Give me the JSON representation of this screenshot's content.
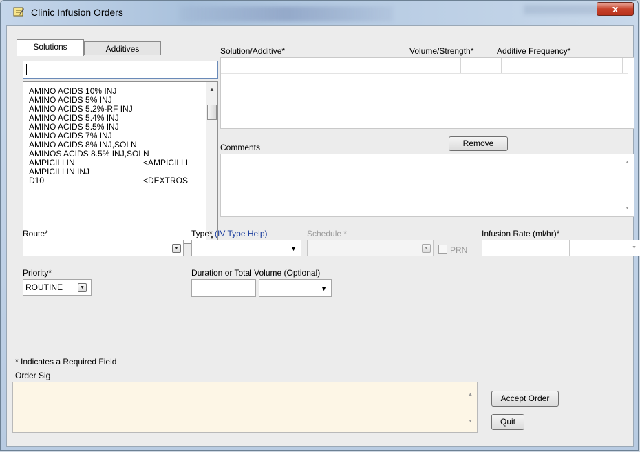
{
  "window": {
    "title": "Clinic Infusion Orders",
    "close_glyph": "x",
    "icon": "notepad-icon"
  },
  "tabs": [
    {
      "label": "Solutions",
      "active": true
    },
    {
      "label": "Additives",
      "active": false
    }
  ],
  "search": {
    "value": "",
    "placeholder": ""
  },
  "solutions_list": [
    {
      "name": "AMINO ACIDS 10% INJ",
      "tag": ""
    },
    {
      "name": "AMINO ACIDS 5% INJ",
      "tag": ""
    },
    {
      "name": "AMINO ACIDS 5.2%-RF INJ",
      "tag": ""
    },
    {
      "name": "AMINO ACIDS 5.4% INJ",
      "tag": ""
    },
    {
      "name": "AMINO ACIDS 5.5% INJ",
      "tag": ""
    },
    {
      "name": "AMINO ACIDS 7% INJ",
      "tag": ""
    },
    {
      "name": "AMINO ACIDS 8% INJ,SOLN",
      "tag": ""
    },
    {
      "name": "AMINOS ACIDS 8.5% INJ,SOLN",
      "tag": ""
    },
    {
      "name": "AMPICILLIN",
      "tag": "<AMPICILLI"
    },
    {
      "name": "AMPICILLIN INJ",
      "tag": ""
    },
    {
      "name": "D10",
      "tag": "<DEXTROS"
    }
  ],
  "grid": {
    "col_solution": "Solution/Additive*",
    "col_volume": "Volume/Strength*",
    "col_frequency": "Additive Frequency*"
  },
  "comments": {
    "label": "Comments",
    "value": ""
  },
  "remove_button": "Remove",
  "route": {
    "label": "Route*",
    "value": ""
  },
  "type": {
    "label": "Type*",
    "help_link": "(IV Type Help)",
    "value": ""
  },
  "schedule": {
    "label": "Schedule *",
    "value": ""
  },
  "prn": {
    "label": "PRN",
    "checked": false
  },
  "infusion_rate": {
    "label": "Infusion Rate (ml/hr)*",
    "value": ""
  },
  "priority": {
    "label": "Priority*",
    "value": "ROUTINE"
  },
  "duration": {
    "label": "Duration or Total Volume (Optional)",
    "value": ""
  },
  "required_note": "* Indicates a Required Field",
  "order_sig": {
    "label": "Order Sig",
    "value": "",
    "bg": "#fdf6e6"
  },
  "accept_button": "Accept Order",
  "quit_button": "Quit"
}
